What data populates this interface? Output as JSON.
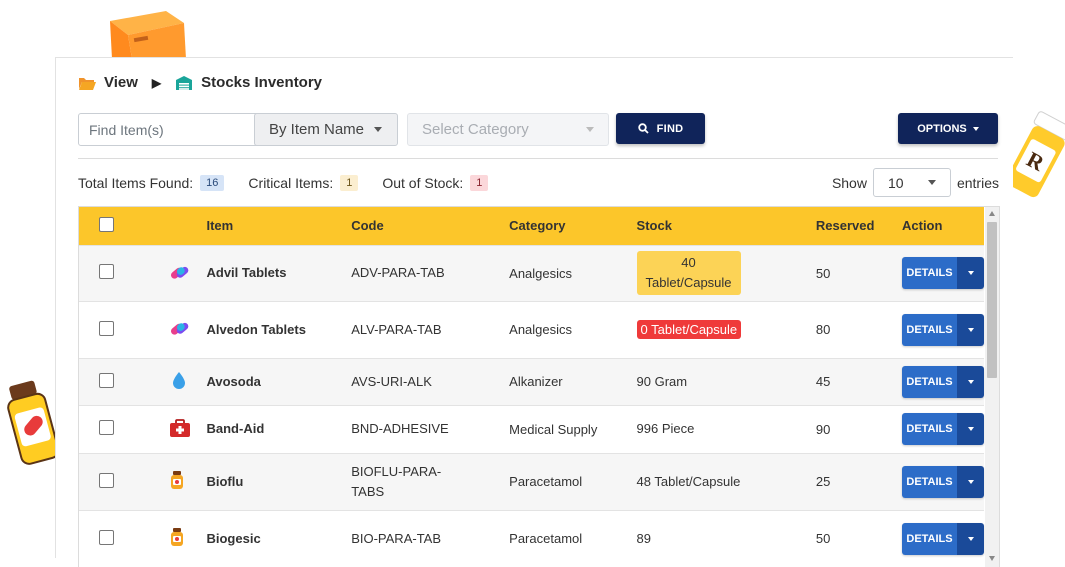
{
  "breadcrumb": {
    "view_label": "View",
    "page_label": "Stocks Inventory"
  },
  "search": {
    "placeholder": "Find Item(s)",
    "sort_select": "By Item Name",
    "category_placeholder": "Select Category",
    "find_label": "FIND",
    "options_label": "OPTIONS"
  },
  "stats": {
    "total_label": "Total Items Found:",
    "total_value": "16",
    "critical_label": "Critical Items:",
    "critical_value": "1",
    "out_label": "Out of Stock:",
    "out_value": "1",
    "show_label": "Show",
    "show_value": "10",
    "entries_label": "entries"
  },
  "table": {
    "headers": {
      "item": "Item",
      "code": "Code",
      "category": "Category",
      "stock": "Stock",
      "reserved": "Reserved",
      "action": "Action"
    },
    "action_label": "DETAILS",
    "rows": [
      {
        "icon": "capsule-icon",
        "item": "Advil Tablets",
        "code": "ADV-PARA-TAB",
        "category": "Analgesics",
        "stock": "40 Tablet/Capsule",
        "stock_status": "critical",
        "reserved": "50"
      },
      {
        "icon": "capsule-icon",
        "item": "Alvedon Tablets",
        "code": "ALV-PARA-TAB",
        "category": "Analgesics",
        "stock": "0 Tablet/Capsule",
        "stock_status": "out",
        "reserved": "80"
      },
      {
        "icon": "droplet-icon",
        "item": "Avosoda",
        "code": "AVS-URI-ALK",
        "category": "Alkanizer",
        "stock": "90 Gram",
        "stock_status": "normal",
        "reserved": "45"
      },
      {
        "icon": "first-aid-kit-icon",
        "item": "Band-Aid",
        "code": "BND-ADHESIVE",
        "category": "Medical Supply",
        "stock": "996 Piece",
        "stock_status": "normal",
        "reserved": "90"
      },
      {
        "icon": "pill-bottle-icon",
        "item": "Bioflu",
        "code": "BIOFLU-PARA-TABS",
        "category": "Paracetamol",
        "stock": "48 Tablet/Capsule",
        "stock_status": "normal",
        "reserved": "25"
      },
      {
        "icon": "pill-bottle-icon",
        "item": "Biogesic",
        "code": "BIO-PARA-TAB",
        "category": "Paracetamol",
        "stock": "89",
        "stock_status": "normal",
        "reserved": "50"
      }
    ]
  },
  "colors": {
    "header_yellow": "#fcc62a",
    "navy_button": "#10245a",
    "details_blue": "#2c6cc8",
    "out_red": "#ef3a3a"
  }
}
